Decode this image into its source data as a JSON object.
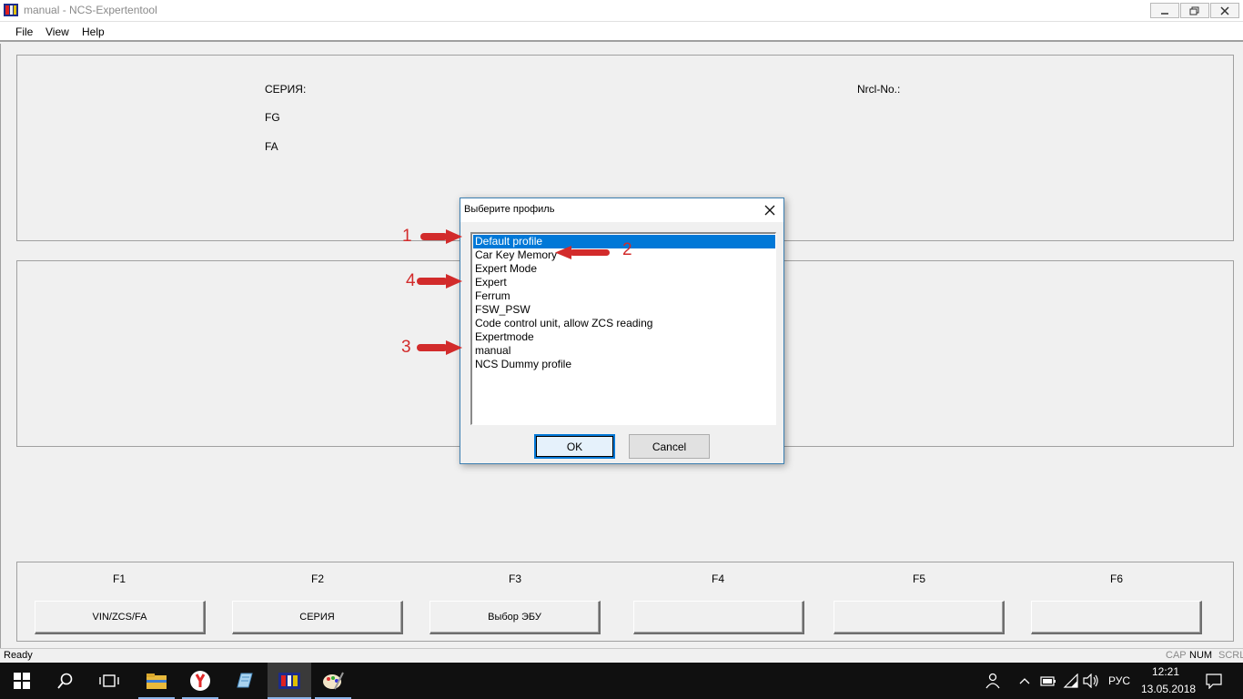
{
  "window": {
    "title": "manual - NCS-Expertentool",
    "minimize_glyph": "—",
    "restore_glyph": "❐",
    "close_glyph": "✕"
  },
  "menu": {
    "file": "File",
    "view": "View",
    "help": "Help"
  },
  "info_panel": {
    "series_label": "СЕРИЯ:",
    "fg_label": "FG",
    "fa_label": "FA",
    "nrcl_label": "Nrcl-No.:"
  },
  "function_keys": [
    {
      "key": "F1",
      "label": "VIN/ZCS/FA"
    },
    {
      "key": "F2",
      "label": "СЕРИЯ"
    },
    {
      "key": "F3",
      "label": "Выбор ЭБУ"
    },
    {
      "key": "F4",
      "label": ""
    },
    {
      "key": "F5",
      "label": ""
    },
    {
      "key": "F6",
      "label": ""
    }
  ],
  "statusbar": {
    "status": "Ready",
    "cap": "CAP",
    "num": "NUM",
    "scrl": "SCRL"
  },
  "dialog": {
    "title": "Выберите профиль",
    "close_glyph": "✕",
    "profiles": [
      "Default profile",
      "Car Key Memory",
      "Expert Mode",
      "Expert",
      "Ferrum",
      "FSW_PSW",
      "Code control unit, allow ZCS reading",
      "Expertmode",
      "manual",
      "NCS Dummy profile"
    ],
    "selected_index": 0,
    "ok_label": "OK",
    "cancel_label": "Cancel"
  },
  "annotations": {
    "n1": "1",
    "n2": "2",
    "n3": "3",
    "n4": "4",
    "color": "#d22b2b"
  },
  "taskbar": {
    "lang": "РУС",
    "time": "12:21",
    "date": "13.05.2018",
    "icons": [
      "windows-start-icon",
      "search-icon",
      "task-view-icon",
      "file-explorer-icon",
      "yandex-browser-icon",
      "notepad-icon",
      "ncs-expert-icon",
      "paint-icon"
    ]
  }
}
